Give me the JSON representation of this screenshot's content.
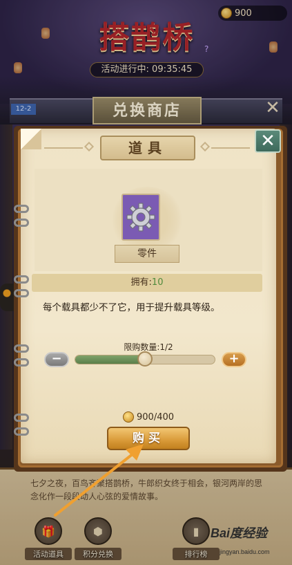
{
  "header": {
    "game_title": "搭鹊桥",
    "coin_amount": "900",
    "event_timer": "活动进行中: 09:35:45",
    "help_symbol": "?"
  },
  "shop": {
    "tag": "12-2",
    "title": "兑换商店",
    "close_symbol": "✕"
  },
  "modal": {
    "title": "道具",
    "close_symbol": "✕",
    "item_name": "零件",
    "owned_label": "拥有:",
    "owned_value": "10",
    "description": "每个载具都少不了它，用于提升载具等级。",
    "limit_label": "限购数量:",
    "limit_value": "1/2",
    "minus_symbol": "−",
    "plus_symbol": "+",
    "slider_fraction": 0.5,
    "cost": "900/400",
    "buy_label": "购买",
    "item_card_color": "#7b5bb3"
  },
  "story": {
    "text": "七夕之夜，百鸟齐聚搭鹊桥，牛郎织女终于相会，银河两岸的思念化作一段段动人心弦的爱情故事。"
  },
  "bottom_tabs": [
    {
      "label": "活动道具"
    },
    {
      "label": "积分兑换"
    },
    {
      "label": "排行榜"
    }
  ],
  "watermark": {
    "logo": "Bai度经验",
    "url": "jingyan.baidu.com"
  },
  "annotation": {
    "arrow_color": "#f0a030"
  }
}
